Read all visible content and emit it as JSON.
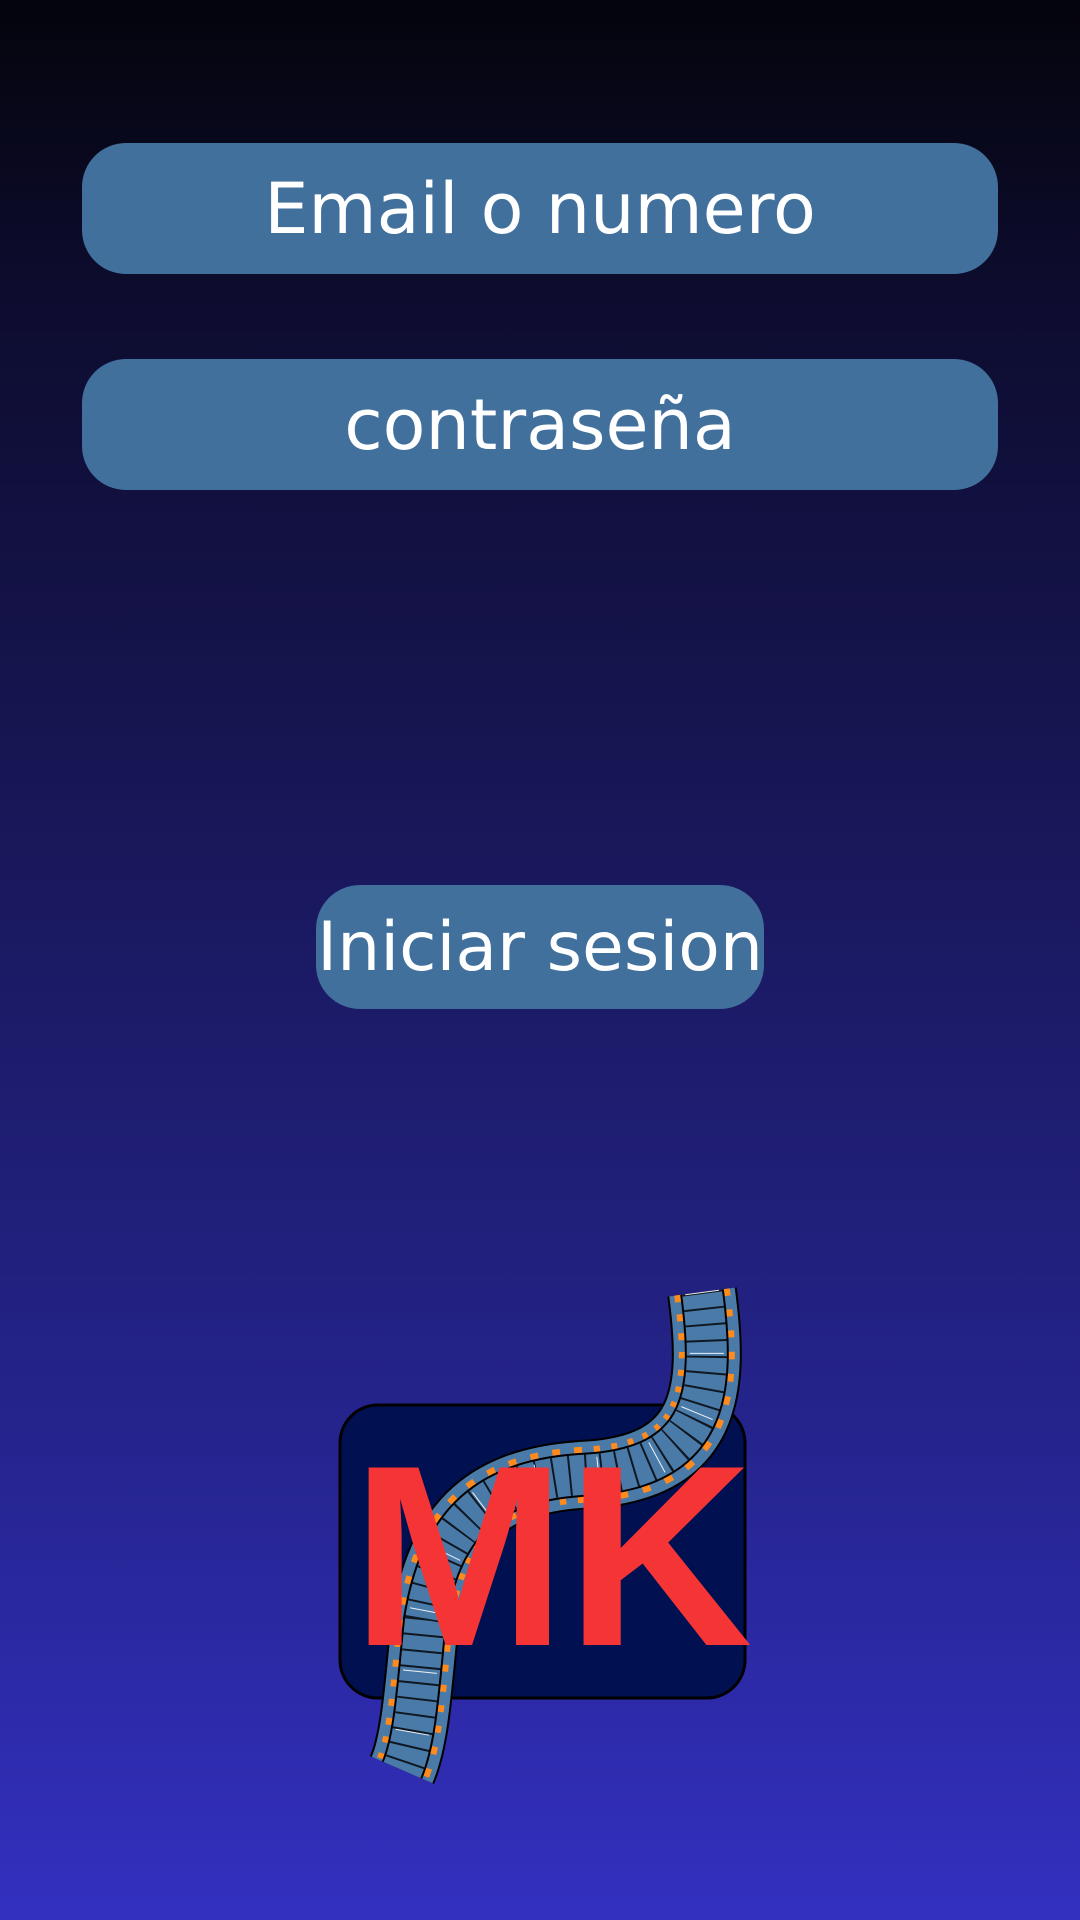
{
  "login_form": {
    "email_placeholder": "Email o numero",
    "password_placeholder": "contraseña",
    "submit_label": "Iniciar sesion"
  },
  "logo": {
    "text": "MK",
    "letter_color": "#f53535",
    "box_color": "#001050",
    "film_color": "#4a7aa8"
  },
  "colors": {
    "field_bg": "#41709c",
    "bg_top": "#04040c",
    "bg_bottom": "#3330c0"
  }
}
